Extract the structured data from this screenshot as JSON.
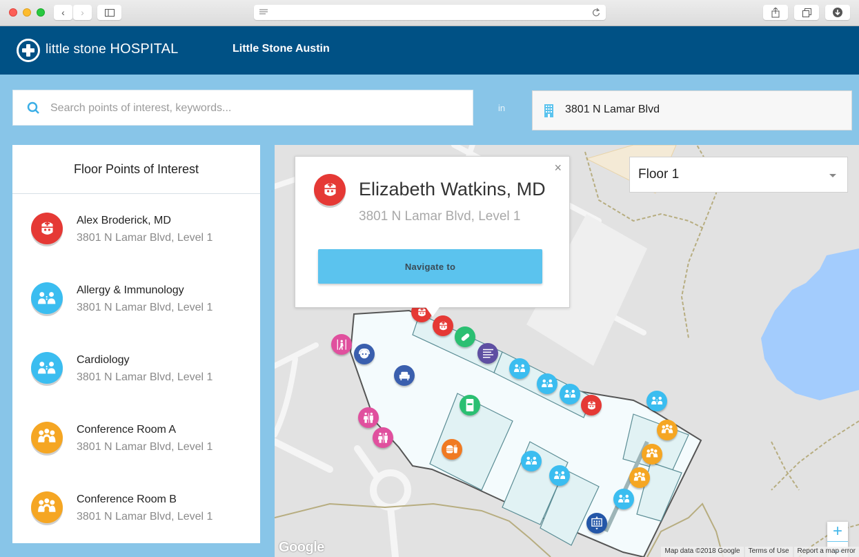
{
  "browser": {
    "back_icon": "chevron-left-icon",
    "forward_icon": "chevron-right-icon",
    "sidebar_icon": "sidebar-icon",
    "reader_icon": "reader-lines-icon",
    "reload_icon": "reload-icon",
    "share_icon": "share-icon",
    "tabs_icon": "tabs-icon",
    "download_icon": "download-icon"
  },
  "header": {
    "logo_light": "little stone ",
    "logo_bold": "HOSPITAL",
    "site_name": "Little Stone Austin"
  },
  "search": {
    "placeholder": "Search points of interest, keywords...",
    "value": "",
    "in_label": "in",
    "building": "3801 N Lamar Blvd"
  },
  "panel": {
    "title": "Floor Points of Interest",
    "items": [
      {
        "name": "Alex Broderick, MD",
        "address": "3801 N Lamar Blvd, Level 1",
        "icon": "doctor-icon",
        "color": "#e53935"
      },
      {
        "name": "Allergy & Immunology",
        "address": "3801 N Lamar Blvd, Level 1",
        "icon": "department-icon",
        "color": "#3bbdf0"
      },
      {
        "name": "Cardiology",
        "address": "3801 N Lamar Blvd, Level 1",
        "icon": "department-icon",
        "color": "#3bbdf0"
      },
      {
        "name": "Conference Room A",
        "address": "3801 N Lamar Blvd, Level 1",
        "icon": "conference-icon",
        "color": "#f5a623"
      },
      {
        "name": "Conference Room B",
        "address": "3801 N Lamar Blvd, Level 1",
        "icon": "conference-icon",
        "color": "#f5a623"
      }
    ]
  },
  "popup": {
    "name": "Elizabeth Watkins, MD",
    "address": "3801 N Lamar Blvd, Level 1",
    "button": "Navigate to",
    "close": "×"
  },
  "map": {
    "floor": "Floor 1",
    "zoom_in": "+",
    "zoom_out": "−",
    "google": "Google",
    "attribution": [
      "Map data ©2018 Google",
      "Terms of Use",
      "Report a map error"
    ]
  },
  "colors": {
    "header": "#005185",
    "background": "#88c5e8",
    "accent": "#5bc3ee",
    "doctor": "#e53935",
    "department": "#3bbdf0",
    "conference": "#f5a623"
  }
}
